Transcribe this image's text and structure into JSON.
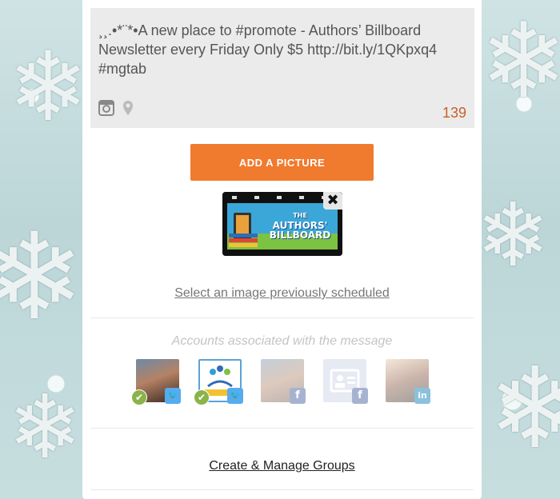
{
  "compose": {
    "message": "¸¸.•*¨*•A new place to #promote - Authors’ Billboard Newsletter every Friday Only $5 http://bit.ly/1QKpxq4 #mgtab",
    "char_count": "139",
    "icons": [
      "instagram-icon",
      "location-pin-icon"
    ]
  },
  "add_picture_label": "ADD A PICTURE",
  "attached_image": {
    "logo_text_line1": "THE",
    "logo_text_line2": "AUTHORS'",
    "logo_text_line3": "BILLBOARD",
    "close_glyph": "✖"
  },
  "select_previous_label": "Select an image previously scheduled",
  "accounts_title": "Accounts associated with the message",
  "accounts": [
    {
      "network": "twitter",
      "network_glyph": "🐦",
      "selected": true
    },
    {
      "network": "twitter",
      "network_glyph": "🐦",
      "selected": true
    },
    {
      "network": "facebook",
      "network_glyph": "f",
      "selected": false
    },
    {
      "network": "facebook",
      "network_glyph": "f",
      "selected": false
    },
    {
      "network": "linkedin",
      "network_glyph": "in",
      "selected": false
    }
  ],
  "groups_link_label": "Create & Manage Groups",
  "colors": {
    "accent": "#f07a2e",
    "twitter": "#55acee",
    "facebook": "#8b9dc3",
    "linkedin": "#4b8fbd",
    "check": "#8ab34a",
    "count": "#c8612a"
  }
}
